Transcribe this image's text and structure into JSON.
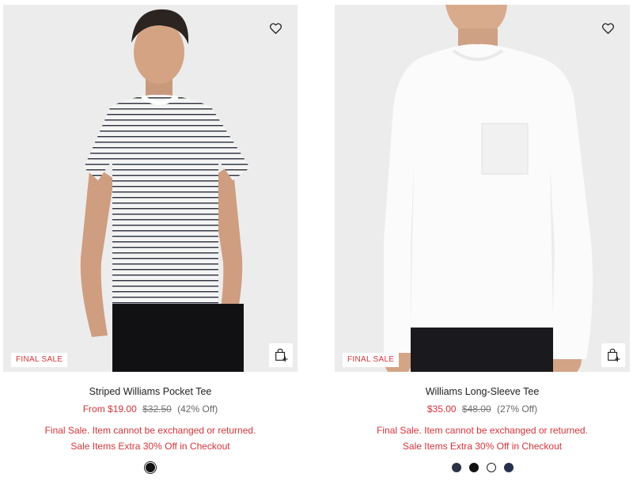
{
  "products": [
    {
      "title": "Striped Williams Pocket Tee",
      "price_prefix": "From ",
      "sale_price": "$19.00",
      "original_price": "$32.50",
      "discount": "(42% Off)",
      "badge": "FINAL SALE",
      "note_final_sale": "Final Sale. Item cannot be exchanged or returned.",
      "note_promo": "Sale Items Extra 30% Off in Checkout",
      "wishlist_icon": "heart-outline-icon",
      "quick_add_icon": "bag-plus-icon",
      "swatches": [
        {
          "color": "#111111",
          "selected": true
        }
      ]
    },
    {
      "title": "Williams Long-Sleeve Tee",
      "price_prefix": "",
      "sale_price": "$35.00",
      "original_price": "$48.00",
      "discount": "(27% Off)",
      "badge": "FINAL SALE",
      "note_final_sale": "Final Sale. Item cannot be exchanged or returned.",
      "note_promo": "Sale Items Extra 30% Off in Checkout",
      "wishlist_icon": "heart-outline-icon",
      "quick_add_icon": "bag-plus-icon",
      "swatches": [
        {
          "color": "#2b3245",
          "selected": false
        },
        {
          "color": "#111111",
          "selected": false
        },
        {
          "color": "#ffffff",
          "selected": true
        },
        {
          "color": "#26304f",
          "selected": false
        }
      ]
    }
  ],
  "colors": {
    "sale_red": "#d6333a",
    "photo_bg": "#ececec"
  }
}
